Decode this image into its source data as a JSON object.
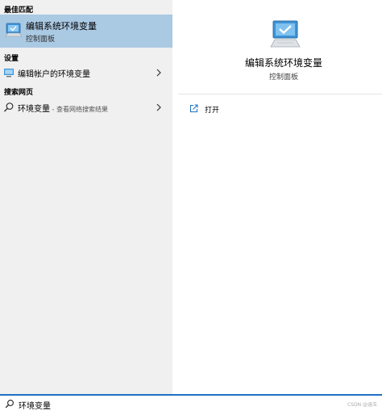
{
  "sections": {
    "best_match": "最佳匹配",
    "settings": "设置",
    "web": "搜索网页"
  },
  "best_match_item": {
    "title": "编辑系统环境变量",
    "subtitle": "控制面板",
    "icon": "monitor-check-icon"
  },
  "settings_item": {
    "label": "编辑帐户的环境变量",
    "icon": "monitor-icon"
  },
  "web_item": {
    "label": "环境变量",
    "suffix": " - 查看网络搜索结果",
    "icon": "search-icon"
  },
  "preview": {
    "title": "编辑系统环境变量",
    "subtitle": "控制面板",
    "icon": "monitor-check-icon"
  },
  "actions": {
    "open": "打开"
  },
  "search": {
    "query": "环境变量"
  },
  "watermark": "CSDN @涵玉",
  "colors": {
    "accent": "#1e6fc4",
    "selected": "#aac9e3",
    "left_bg": "#f0f0f0"
  }
}
